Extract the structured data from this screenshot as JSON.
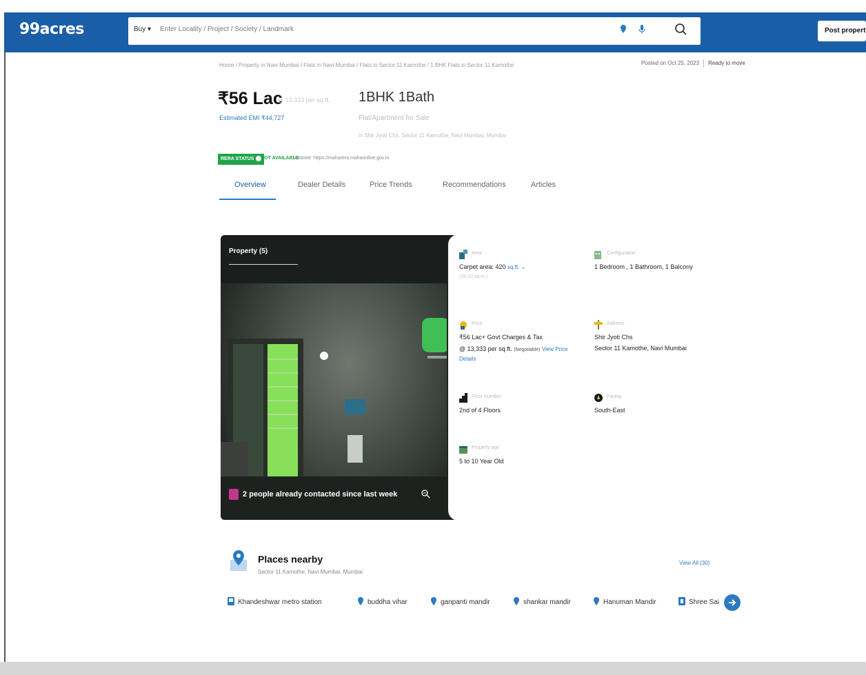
{
  "header": {
    "logo": "99acres",
    "buy_label": "Buy",
    "search_placeholder": "Enter Locality / Project / Society / Landmark",
    "post_property": "Post property"
  },
  "breadcrumb": "Home / Property in Navi Mumbai / Flats in Navi Mumbai / Flats in Sector 11 Kamothe / 1 BHK Flats in Sector 11 Kamothe",
  "posted": {
    "date": "Posted on Oct 25, 2023",
    "status": "Ready to move"
  },
  "listing": {
    "price": "₹56 Lac",
    "price_sub": "@ 13,333 per sq.ft.",
    "emi": "Estimated EMI ₹44,727",
    "bhk": "1BHK 1Bath",
    "type": "Flat/Apartment for Sale",
    "address": "in Shir Jyoti Chs, Sector 11 Kamothe, Navi Mumbai, Mumbai"
  },
  "rera": {
    "label": "RERA STATUS",
    "status": "NOT AVAILABLE",
    "website": "Website: https://maharera.mahaonline.gov.in"
  },
  "tabs": [
    {
      "label": "Overview",
      "active": true
    },
    {
      "label": "Dealer Details",
      "active": false
    },
    {
      "label": "Price Trends",
      "active": false
    },
    {
      "label": "Recommendations",
      "active": false
    },
    {
      "label": "Articles",
      "active": false
    }
  ],
  "photo": {
    "label": "Property (5)",
    "caption": "2 people already contacted since last week"
  },
  "details": {
    "area": {
      "label": "Area",
      "value": "Carpet area: 420",
      "unit": "sq.ft.",
      "extra": "(39.02 sq.m.)"
    },
    "configuration": {
      "label": "Configuration",
      "value": "1 Bedroom , 1 Bathroom, 1 Balcony"
    },
    "price": {
      "label": "Price",
      "value": "₹56 Lac+ Govt Charges & Tax",
      "extra1": "@ 13,333 per sq.ft.",
      "extra2": "(Negotiable)",
      "extra3": "View Price",
      "extra4": "Details"
    },
    "address": {
      "label": "Address",
      "value": "Shir Jyoti Chs",
      "value2": "Sector 11 Kamothe, Navi Mumbai"
    },
    "floor": {
      "label": "Floor Number",
      "value": "2nd of 4 Floors"
    },
    "facing": {
      "label": "Facing",
      "value": "South-East"
    },
    "age": {
      "label": "Property age",
      "value": "5 to 10 Year Old"
    }
  },
  "places": {
    "title": "Places nearby",
    "subtitle": "Sector 11 Kamothe, Navi Mumbai, Mumbai",
    "view_all": "View All (30)",
    "chips": [
      "Khandeshwar metro station",
      "buddha vihar",
      "ganpanti mandir",
      "shankar mandir",
      "Hanuman Mandir",
      "Shree Sai"
    ]
  },
  "colors": {
    "brand": "#1b5ea8",
    "link": "#2a7ac2",
    "rera_green": "#22a34a"
  }
}
